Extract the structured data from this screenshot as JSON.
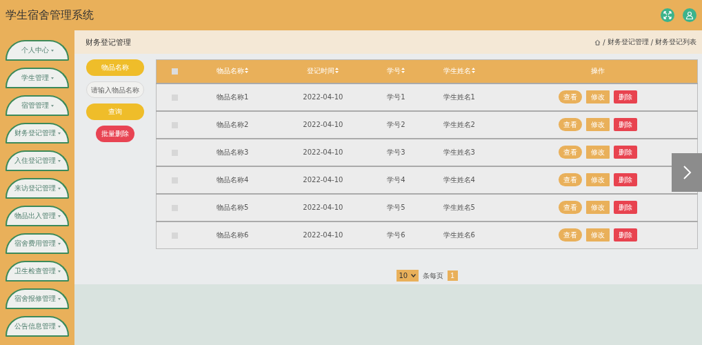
{
  "header": {
    "title": "学生宿舍管理系统"
  },
  "sidebar": {
    "items": [
      {
        "label": "个人中心"
      },
      {
        "label": "学生管理"
      },
      {
        "label": "宿管管理"
      },
      {
        "label": "财务登记管理"
      },
      {
        "label": "入住登记管理"
      },
      {
        "label": "来访登记管理"
      },
      {
        "label": "物品出入管理"
      },
      {
        "label": "宿舍费用管理"
      },
      {
        "label": "卫生检查管理"
      },
      {
        "label": "宿舍报修管理"
      },
      {
        "label": "公告信息管理"
      }
    ]
  },
  "page_title": "财务登记管理",
  "breadcrumb": [
    {
      "separator": "/",
      "label": "财务登记管理"
    },
    {
      "separator": "/",
      "label": "财务登记列表"
    }
  ],
  "search": {
    "field_label": "物品名称",
    "placeholder": "请输入物品名称",
    "query_button": "查询",
    "batch_delete_button": "批量删除"
  },
  "table": {
    "select_all": {
      "checked": false
    },
    "columns": [
      {
        "label": "物品名称",
        "sortable": true
      },
      {
        "label": "登记时间",
        "sortable": true
      },
      {
        "label": "学号",
        "sortable": true
      },
      {
        "label": "学生姓名",
        "sortable": true
      },
      {
        "label": "操作",
        "sortable": false
      }
    ],
    "rows": [
      {
        "checked": false,
        "cells": [
          "物品名称1",
          "2022-04-10",
          "学号1",
          "学生姓名1"
        ],
        "actions": [
          {
            "label": "查看",
            "kind": "view"
          },
          {
            "label": "修改",
            "kind": "edit"
          },
          {
            "label": "删除",
            "kind": "delete"
          }
        ]
      },
      {
        "checked": false,
        "cells": [
          "物品名称2",
          "2022-04-10",
          "学号2",
          "学生姓名2"
        ],
        "actions": [
          {
            "label": "查看",
            "kind": "view"
          },
          {
            "label": "修改",
            "kind": "edit"
          },
          {
            "label": "删除",
            "kind": "delete"
          }
        ]
      },
      {
        "checked": false,
        "cells": [
          "物品名称3",
          "2022-04-10",
          "学号3",
          "学生姓名3"
        ],
        "actions": [
          {
            "label": "查看",
            "kind": "view"
          },
          {
            "label": "修改",
            "kind": "edit"
          },
          {
            "label": "删除",
            "kind": "delete"
          }
        ]
      },
      {
        "checked": false,
        "cells": [
          "物品名称4",
          "2022-04-10",
          "学号4",
          "学生姓名4"
        ],
        "actions": [
          {
            "label": "查看",
            "kind": "view"
          },
          {
            "label": "修改",
            "kind": "edit"
          },
          {
            "label": "删除",
            "kind": "delete"
          }
        ]
      },
      {
        "checked": false,
        "cells": [
          "物品名称5",
          "2022-04-10",
          "学号5",
          "学生姓名5"
        ],
        "actions": [
          {
            "label": "查看",
            "kind": "view"
          },
          {
            "label": "修改",
            "kind": "edit"
          },
          {
            "label": "删除",
            "kind": "delete"
          }
        ]
      },
      {
        "checked": false,
        "cells": [
          "物品名称6",
          "2022-04-10",
          "学号6",
          "学生姓名6"
        ],
        "actions": [
          {
            "label": "查看",
            "kind": "view"
          },
          {
            "label": "修改",
            "kind": "edit"
          },
          {
            "label": "删除",
            "kind": "delete"
          }
        ]
      }
    ]
  },
  "pagination": {
    "page_size": "10",
    "page_size_label": "条每页",
    "pages": [
      {
        "label": "1",
        "selected": true
      }
    ]
  }
}
